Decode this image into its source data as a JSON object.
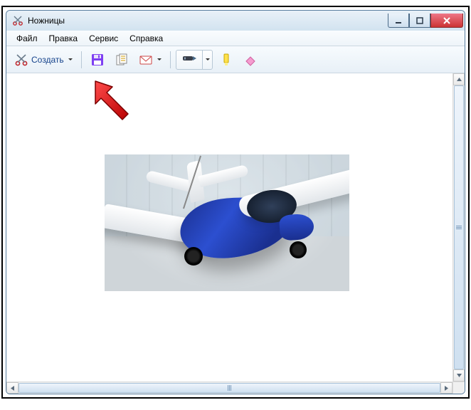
{
  "window": {
    "title": "Ножницы"
  },
  "menu": {
    "file": "Файл",
    "edit": "Правка",
    "tools": "Сервис",
    "help": "Справка"
  },
  "toolbar": {
    "new_label": "Создать"
  },
  "icons": {
    "app": "scissors-icon",
    "new": "scissors-icon",
    "save": "floppy-icon",
    "copy": "copy-icon",
    "send": "envelope-icon",
    "pen": "pen-icon",
    "highlighter": "highlighter-icon",
    "eraser": "eraser-icon"
  },
  "colors": {
    "accent": "#2c4fd0",
    "titlebar": "#d2e3f0",
    "close": "#c33"
  }
}
